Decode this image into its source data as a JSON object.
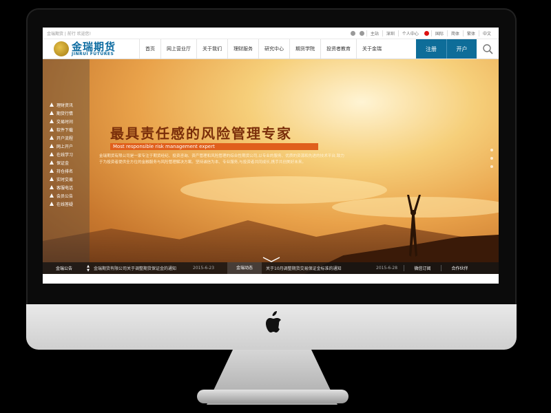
{
  "topbar": {
    "left_text": "金瑞期货 | 前行 欢迎您!",
    "links": [
      "主站",
      "深圳",
      "个人中心",
      "国际",
      "简体",
      "繁体",
      "中文"
    ]
  },
  "brand": {
    "name_cn": "金瑞期货",
    "name_en": "JINRUI FUTURES"
  },
  "nav": {
    "items": [
      "首页",
      "网上营业厅",
      "关于我们",
      "理财服务",
      "研究中心",
      "期货学院",
      "投资者教育",
      "关于金瑞"
    ],
    "register": "注册",
    "open_account": "开户"
  },
  "sidebar": {
    "items": [
      "理财资讯",
      "期货行情",
      "交易时间",
      "软件下载",
      "开户流程",
      "网上开户",
      "在线学习",
      "保证金",
      "持仓排名",
      "实时交易",
      "客服电话",
      "会员公告",
      "在线答疑"
    ]
  },
  "hero": {
    "title": "最具责任感的风险管理专家",
    "subtitle": "Most responsible risk management expert",
    "description": "金瑞期货有限公司是一家专注于期货经纪、投资咨询、资产管理和风险管理的综合性期货公司,以专业的服务、优质的资源和先进的技术平台,致力于为投资者提供全方位的金融服务与风险管理解决方案。坚持诚信为本、专业服务,与投资者共同成长,携手共创美好未来。"
  },
  "ticker": {
    "label1": "金瑞公告",
    "text1": "金瑞期货有限公司关于调整期货保证金的通知",
    "date1": "2015-6-23",
    "label2": "金瑞动态",
    "text2": "关于10月调整期货交易保证金标准的通知",
    "date2": "2015-6-28",
    "btn1": "微信订阅",
    "btn2": "合作伙伴"
  },
  "colors": {
    "brand_blue": "#0e6d99",
    "title_brown": "#7a2e0a",
    "accent_orange": "#e05f1c"
  }
}
